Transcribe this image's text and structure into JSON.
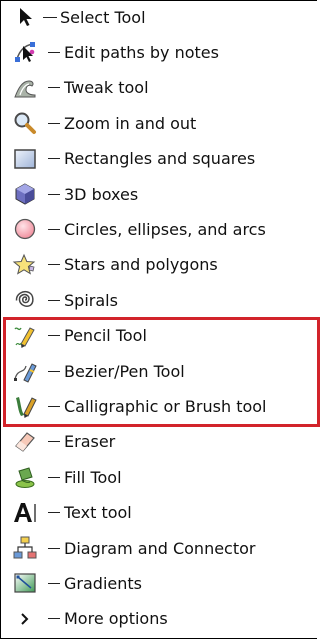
{
  "highlight_color": "#d2232a",
  "tools": [
    {
      "label": "Select Tool",
      "icon": "arrow-cursor-icon"
    },
    {
      "label": "Edit paths by notes",
      "icon": "node-edit-icon"
    },
    {
      "label": "Tweak tool",
      "icon": "tweak-icon"
    },
    {
      "label": "Zoom in and out",
      "icon": "zoom-icon"
    },
    {
      "label": "Rectangles and squares",
      "icon": "rectangle-icon"
    },
    {
      "label": "3D boxes",
      "icon": "3d-box-icon"
    },
    {
      "label": "Circles, ellipses, and arcs",
      "icon": "circle-icon"
    },
    {
      "label": "Stars and polygons",
      "icon": "star-icon"
    },
    {
      "label": "Spirals",
      "icon": "spiral-icon"
    },
    {
      "label": "Pencil Tool",
      "icon": "pencil-icon"
    },
    {
      "label": "Bezier/Pen Tool",
      "icon": "pen-icon"
    },
    {
      "label": "Calligraphic or Brush tool",
      "icon": "calligraphy-icon"
    },
    {
      "label": "Eraser",
      "icon": "eraser-icon"
    },
    {
      "label": "Fill Tool",
      "icon": "paint-bucket-icon"
    },
    {
      "label": "Text tool",
      "icon": "text-icon"
    },
    {
      "label": "Diagram and Connector",
      "icon": "connector-icon"
    },
    {
      "label": "Gradients",
      "icon": "gradient-icon"
    },
    {
      "label": "More options",
      "icon": "chevron-right-icon"
    }
  ]
}
